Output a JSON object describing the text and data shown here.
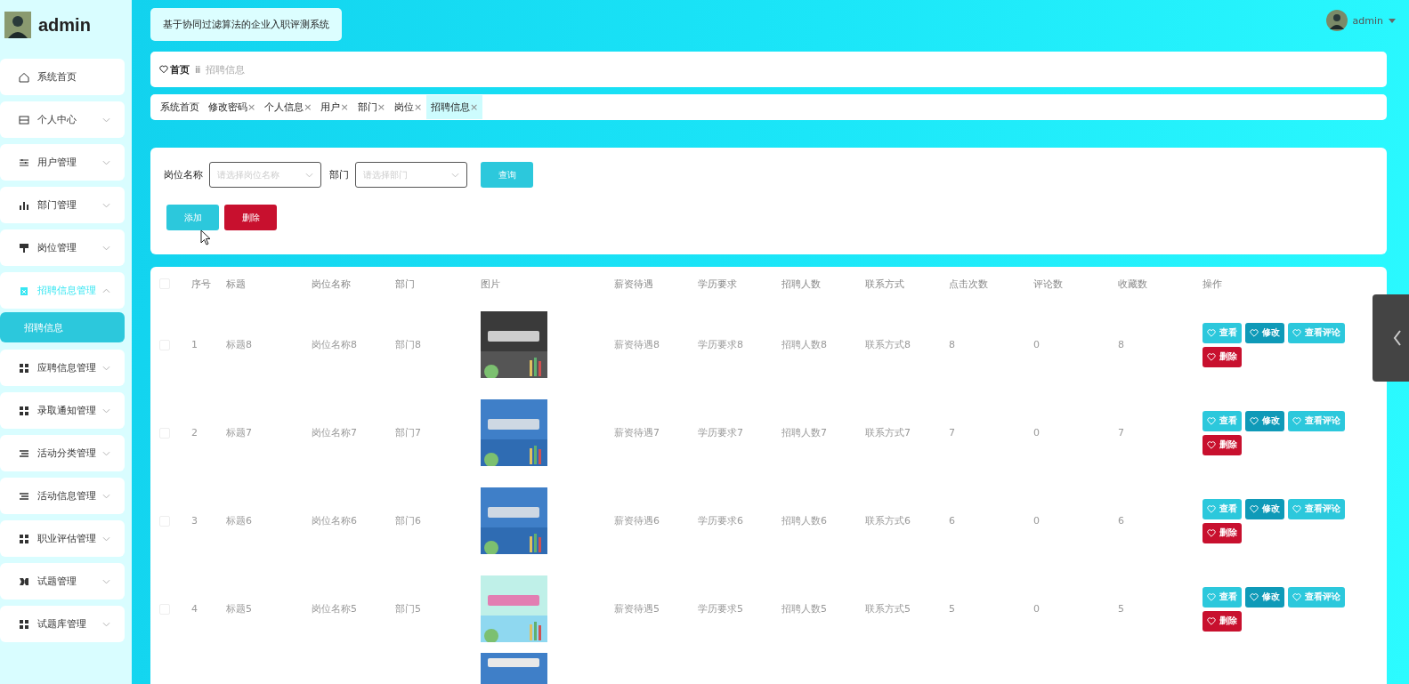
{
  "sidebar": {
    "title": "admin",
    "items": [
      {
        "label": "系统首页",
        "expandable": false,
        "selected": false
      },
      {
        "label": "个人中心",
        "expandable": true,
        "expanded": false,
        "selected": false
      },
      {
        "label": "用户管理",
        "expandable": true,
        "expanded": false,
        "selected": false
      },
      {
        "label": "部门管理",
        "expandable": true,
        "expanded": false,
        "selected": false
      },
      {
        "label": "岗位管理",
        "expandable": true,
        "expanded": false,
        "selected": false
      },
      {
        "label": "招聘信息管理",
        "expandable": true,
        "expanded": true,
        "selected": true,
        "children": [
          {
            "label": "招聘信息",
            "selected": true
          }
        ]
      },
      {
        "label": "应聘信息管理",
        "expandable": true,
        "expanded": false,
        "selected": false
      },
      {
        "label": "录取通知管理",
        "expandable": true,
        "expanded": false,
        "selected": false
      },
      {
        "label": "活动分类管理",
        "expandable": true,
        "expanded": false,
        "selected": false
      },
      {
        "label": "活动信息管理",
        "expandable": true,
        "expanded": false,
        "selected": false
      },
      {
        "label": "职业评估管理",
        "expandable": true,
        "expanded": false,
        "selected": false
      },
      {
        "label": "试题管理",
        "expandable": true,
        "expanded": false,
        "selected": false
      },
      {
        "label": "试题库管理",
        "expandable": true,
        "expanded": false,
        "selected": false
      }
    ]
  },
  "header": {
    "system_title": "基于协同过滤算法的企业入职评测系统",
    "user": "admin"
  },
  "breadcrumb": [
    {
      "label": "首页",
      "current": false
    },
    {
      "label": "招聘信息",
      "current": true
    }
  ],
  "breadcrumb_separator": "ⅲ",
  "tabs": [
    {
      "label": "系统首页",
      "closable": false,
      "selected": false
    },
    {
      "label": "修改密码",
      "closable": true,
      "selected": false
    },
    {
      "label": "个人信息",
      "closable": true,
      "selected": false
    },
    {
      "label": "用户",
      "closable": true,
      "selected": false
    },
    {
      "label": "部门",
      "closable": true,
      "selected": false
    },
    {
      "label": "岗位",
      "closable": true,
      "selected": false
    },
    {
      "label": "招聘信息",
      "closable": true,
      "selected": true
    }
  ],
  "tab_close": "×",
  "search": {
    "fields": [
      {
        "label": "岗位名称",
        "placeholder": "请选择岗位名称"
      },
      {
        "label": "部门",
        "placeholder": "请选择部门"
      }
    ],
    "query_button": "查询"
  },
  "toolbar": [
    {
      "label": "添加",
      "kind": "add"
    },
    {
      "label": "删除",
      "kind": "delete"
    }
  ],
  "table": {
    "header_checked": false,
    "columns": [
      "序号",
      "标题",
      "岗位名称",
      "部门",
      "图片",
      "薪资待遇",
      "学历要求",
      "招聘人数",
      "联系方式",
      "点击次数",
      "评论数",
      "收藏数",
      "操作"
    ],
    "rows": [
      {
        "checked": false,
        "cells": [
          "1",
          "标题8",
          "岗位名称8",
          "部门8",
          "",
          "薪资待遇8",
          "学历要求8",
          "招聘人数8",
          "联系方式8",
          "8",
          "0",
          "8"
        ],
        "actions": [
          {
            "label": "查看",
            "kind": "view"
          },
          {
            "label": "修改",
            "kind": "edit"
          },
          {
            "label": "查看评论",
            "kind": "view"
          },
          {
            "label": "删除",
            "kind": "delete"
          }
        ]
      },
      {
        "checked": false,
        "cells": [
          "2",
          "标题7",
          "岗位名称7",
          "部门7",
          "",
          "薪资待遇7",
          "学历要求7",
          "招聘人数7",
          "联系方式7",
          "7",
          "0",
          "7"
        ],
        "actions": [
          {
            "label": "查看",
            "kind": "view"
          },
          {
            "label": "修改",
            "kind": "edit"
          },
          {
            "label": "查看评论",
            "kind": "view"
          },
          {
            "label": "删除",
            "kind": "delete"
          }
        ]
      },
      {
        "checked": false,
        "cells": [
          "3",
          "标题6",
          "岗位名称6",
          "部门6",
          "",
          "薪资待遇6",
          "学历要求6",
          "招聘人数6",
          "联系方式6",
          "6",
          "0",
          "6"
        ],
        "actions": [
          {
            "label": "查看",
            "kind": "view"
          },
          {
            "label": "修改",
            "kind": "edit"
          },
          {
            "label": "查看评论",
            "kind": "view"
          },
          {
            "label": "删除",
            "kind": "delete"
          }
        ]
      },
      {
        "checked": false,
        "cells": [
          "4",
          "标题5",
          "岗位名称5",
          "部门5",
          "",
          "薪资待遇5",
          "学历要求5",
          "招聘人数5",
          "联系方式5",
          "5",
          "0",
          "5"
        ],
        "actions": [
          {
            "label": "查看",
            "kind": "view"
          },
          {
            "label": "修改",
            "kind": "edit"
          },
          {
            "label": "查看评论",
            "kind": "view"
          },
          {
            "label": "删除",
            "kind": "delete"
          }
        ]
      }
    ]
  }
}
